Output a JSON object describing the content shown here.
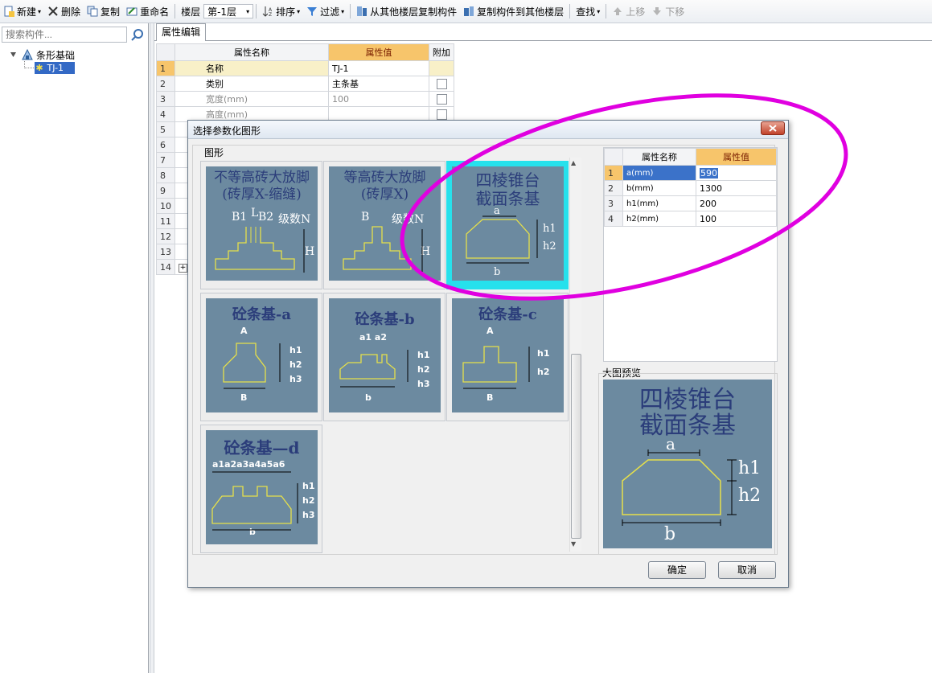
{
  "toolbar": {
    "new": "新建",
    "delete": "删除",
    "copy": "复制",
    "rename": "重命名",
    "floor_label": "楼层",
    "floor_value": "第-1层",
    "sort": "排序",
    "filter": "过滤",
    "copy_from_floor": "从其他楼层复制构件",
    "copy_to_floor": "复制构件到其他楼层",
    "find": "查找",
    "move_up": "上移",
    "move_down": "下移"
  },
  "left_panel": {
    "search_placeholder": "搜索构件...",
    "tree_root": "条形基础",
    "tree_child": "TJ-1"
  },
  "property_panel": {
    "tab": "属性编辑",
    "headers": {
      "name": "属性名称",
      "value": "属性值",
      "extra": "附加"
    },
    "rows": [
      {
        "n": "1",
        "name": "名称",
        "value": "TJ-1"
      },
      {
        "n": "2",
        "name": "类别",
        "value": "主条基"
      },
      {
        "n": "3",
        "name": "宽度(mm)",
        "value": "100"
      },
      {
        "n": "4",
        "name": "高度(mm)",
        "value": ""
      },
      {
        "n": "5"
      },
      {
        "n": "6"
      },
      {
        "n": "7"
      },
      {
        "n": "8"
      },
      {
        "n": "9"
      },
      {
        "n": "10"
      },
      {
        "n": "11"
      },
      {
        "n": "12"
      },
      {
        "n": "13"
      },
      {
        "n": "14"
      }
    ]
  },
  "dialog": {
    "title": "选择参数化图形",
    "group_label": "图形",
    "shapes": [
      {
        "line1": "不等高砖大放脚",
        "line2": "(砖厚X-缩缝)",
        "labels": [
          "B1",
          "L",
          "B2",
          "级数N",
          "H"
        ]
      },
      {
        "line1": "等高砖大放脚",
        "line2": "(砖厚X)",
        "labels": [
          "B",
          "级数N",
          "H"
        ]
      },
      {
        "line1": "四棱锥台",
        "line2": "截面条基",
        "labels": [
          "a",
          "h1",
          "h2",
          "b"
        ]
      },
      {
        "line1": "砼条基-a",
        "labels": [
          "A",
          "h1",
          "h2",
          "h3",
          "B"
        ]
      },
      {
        "line1": "砼条基-b",
        "labels": [
          "a1 a2",
          "h1",
          "h2",
          "h3",
          "b"
        ]
      },
      {
        "line1": "砼条基-c",
        "labels": [
          "A",
          "h1",
          "h2",
          "B"
        ]
      },
      {
        "line1": "砼条基—d",
        "labels": [
          "a1a2a3a4a5a6",
          "h1",
          "h2",
          "h3",
          "b"
        ]
      }
    ],
    "param_table": {
      "headers": {
        "name": "属性名称",
        "value": "属性值"
      },
      "rows": [
        {
          "n": "1",
          "name": "a(mm)",
          "value": "590"
        },
        {
          "n": "2",
          "name": "b(mm)",
          "value": "1300"
        },
        {
          "n": "3",
          "name": "h1(mm)",
          "value": "200"
        },
        {
          "n": "4",
          "name": "h2(mm)",
          "value": "100"
        }
      ]
    },
    "preview_label": "大图预览",
    "preview": {
      "line1": "四棱锥台",
      "line2": "截面条基",
      "labels": [
        "a",
        "h1",
        "h2",
        "b"
      ]
    },
    "ok": "确定",
    "cancel": "取消"
  },
  "colors": {
    "thumb_bg": "#6c8aa0",
    "selected_border": "#26e1ec",
    "annotation_ellipse": "#e000e0",
    "value_header": "#f7c56b"
  }
}
